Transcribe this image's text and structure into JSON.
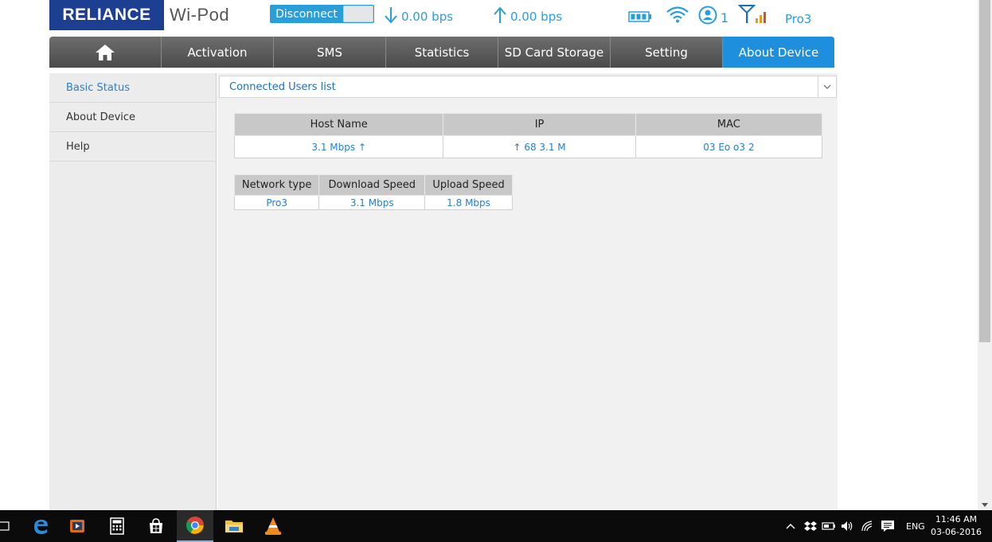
{
  "header": {
    "brand": "RELIANCE",
    "product": "Wi-Pod",
    "connection_button": "Disconnect",
    "download_rate": "0.00 bps",
    "upload_rate": "0.00 bps",
    "connected_users": "1",
    "network_type": "Pro3"
  },
  "nav": {
    "items": [
      {
        "label": "Activation"
      },
      {
        "label": "SMS"
      },
      {
        "label": "Statistics"
      },
      {
        "label": "SD Card Storage"
      },
      {
        "label": "Setting"
      },
      {
        "label": "About Device",
        "active": true
      }
    ]
  },
  "sidebar": {
    "items": [
      {
        "label": "Basic Status",
        "active": true
      },
      {
        "label": "About Device"
      },
      {
        "label": "Help"
      }
    ]
  },
  "main": {
    "panel_title": "Connected Users list",
    "users_table": {
      "headers": [
        "Host Name",
        "IP",
        "MAC"
      ],
      "rows": [
        [
          "3.1 Mbps ↑",
          "↑ 68  3.1 M",
          "03  Eo  o3  2"
        ]
      ]
    },
    "speed_table": {
      "headers": [
        "Network type",
        "Download Speed",
        "Upload Speed"
      ],
      "rows": [
        [
          "Pro3",
          "3.1 Mbps",
          "1.8 Mbps"
        ]
      ]
    }
  },
  "taskbar": {
    "language": "ENG",
    "time": "11:46 AM",
    "date": "03-06-2016"
  },
  "colors": {
    "accent": "#2a9ed8",
    "brand": "#1c3f92",
    "nav_active": "#1e8fdc"
  }
}
